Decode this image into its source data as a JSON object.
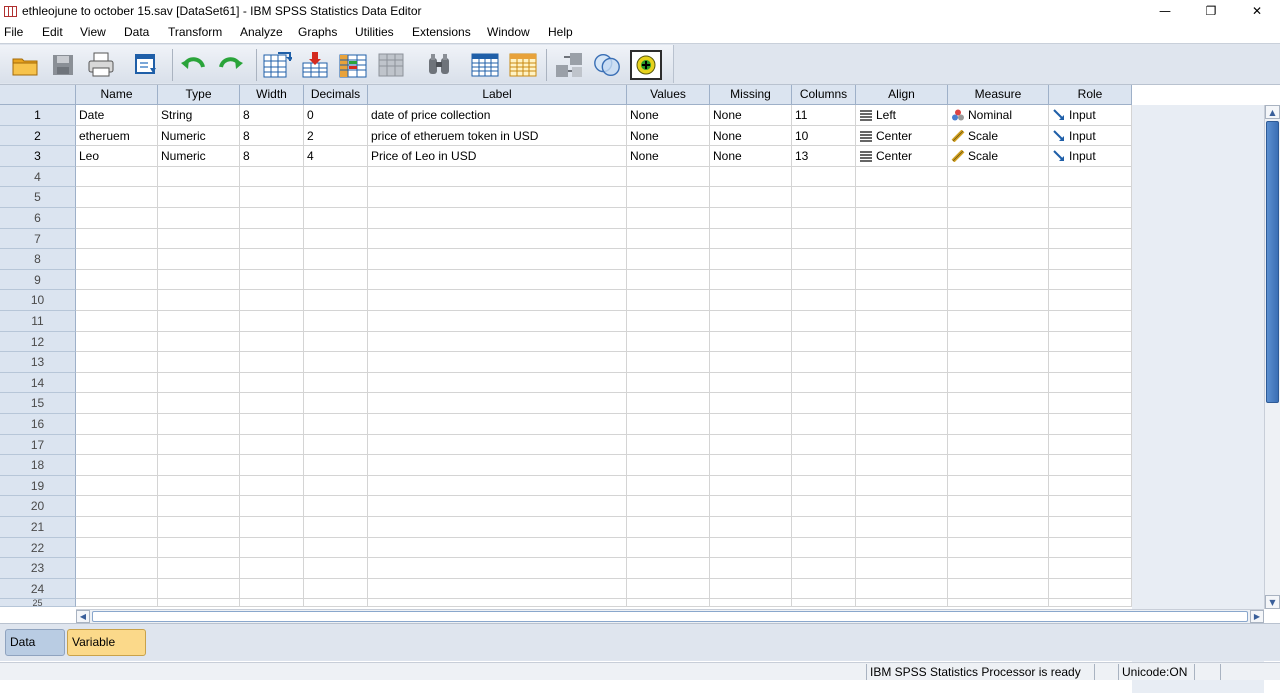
{
  "window": {
    "title": "ethleojune to october 15.sav [DataSet61] - IBM SPSS Statistics Data Editor",
    "minimize_icon": "minimize-icon",
    "maximize_icon": "restore-icon",
    "close_icon": "close-icon"
  },
  "menu": [
    "File",
    "Edit",
    "View",
    "Data",
    "Transform",
    "Analyze",
    "Graphs",
    "Utilities",
    "Extensions",
    "Window",
    "Help"
  ],
  "toolbar": {
    "icons": [
      "open-folder-icon",
      "save-icon",
      "print-icon",
      "dialog-recall-icon",
      "undo-icon",
      "redo-icon",
      "goto-case-icon",
      "goto-variable-icon",
      "variables-icon",
      "split-file-icon",
      "find-icon",
      "insert-cases-icon",
      "insert-variable-icon",
      "value-labels-icon",
      "use-sets-icon",
      "show-all-variables-icon"
    ]
  },
  "grid": {
    "columns": [
      "Name",
      "Type",
      "Width",
      "Decimals",
      "Label",
      "Values",
      "Missing",
      "Columns",
      "Align",
      "Measure",
      "Role"
    ],
    "rows": [
      {
        "name": "Date",
        "type": "String",
        "width": "8",
        "decimals": "0",
        "label": "date of price collection",
        "values": "None",
        "missing": "None",
        "columns": "11",
        "align": "Left",
        "measure": "Nominal",
        "role": "Input"
      },
      {
        "name": "etheruem",
        "type": "Numeric",
        "width": "8",
        "decimals": "2",
        "label": "price of etheruem token in USD",
        "values": "None",
        "missing": "None",
        "columns": "10",
        "align": "Center",
        "measure": "Scale",
        "role": "Input"
      },
      {
        "name": "Leo",
        "type": "Numeric",
        "width": "8",
        "decimals": "4",
        "label": "Price of Leo in USD",
        "values": "None",
        "missing": "None",
        "columns": "13",
        "align": "Center",
        "measure": "Scale",
        "role": "Input"
      }
    ],
    "row_numbers": [
      "1",
      "2",
      "3",
      "4",
      "5",
      "6",
      "7",
      "8",
      "9",
      "10",
      "11",
      "12",
      "13",
      "14",
      "15",
      "16",
      "17",
      "18",
      "19",
      "20",
      "21",
      "22",
      "23",
      "24",
      "25"
    ]
  },
  "tabs": {
    "data_view": "Data View",
    "variable_view": "Variable View",
    "active": "variable_view"
  },
  "status": {
    "processor": "IBM SPSS Statistics Processor is ready",
    "unicode": "Unicode:ON"
  },
  "colors": {
    "accent_tab": "#fbd98a",
    "header_bg": "#dbe4f0",
    "scroll_thumb": "#3b6fb5"
  }
}
